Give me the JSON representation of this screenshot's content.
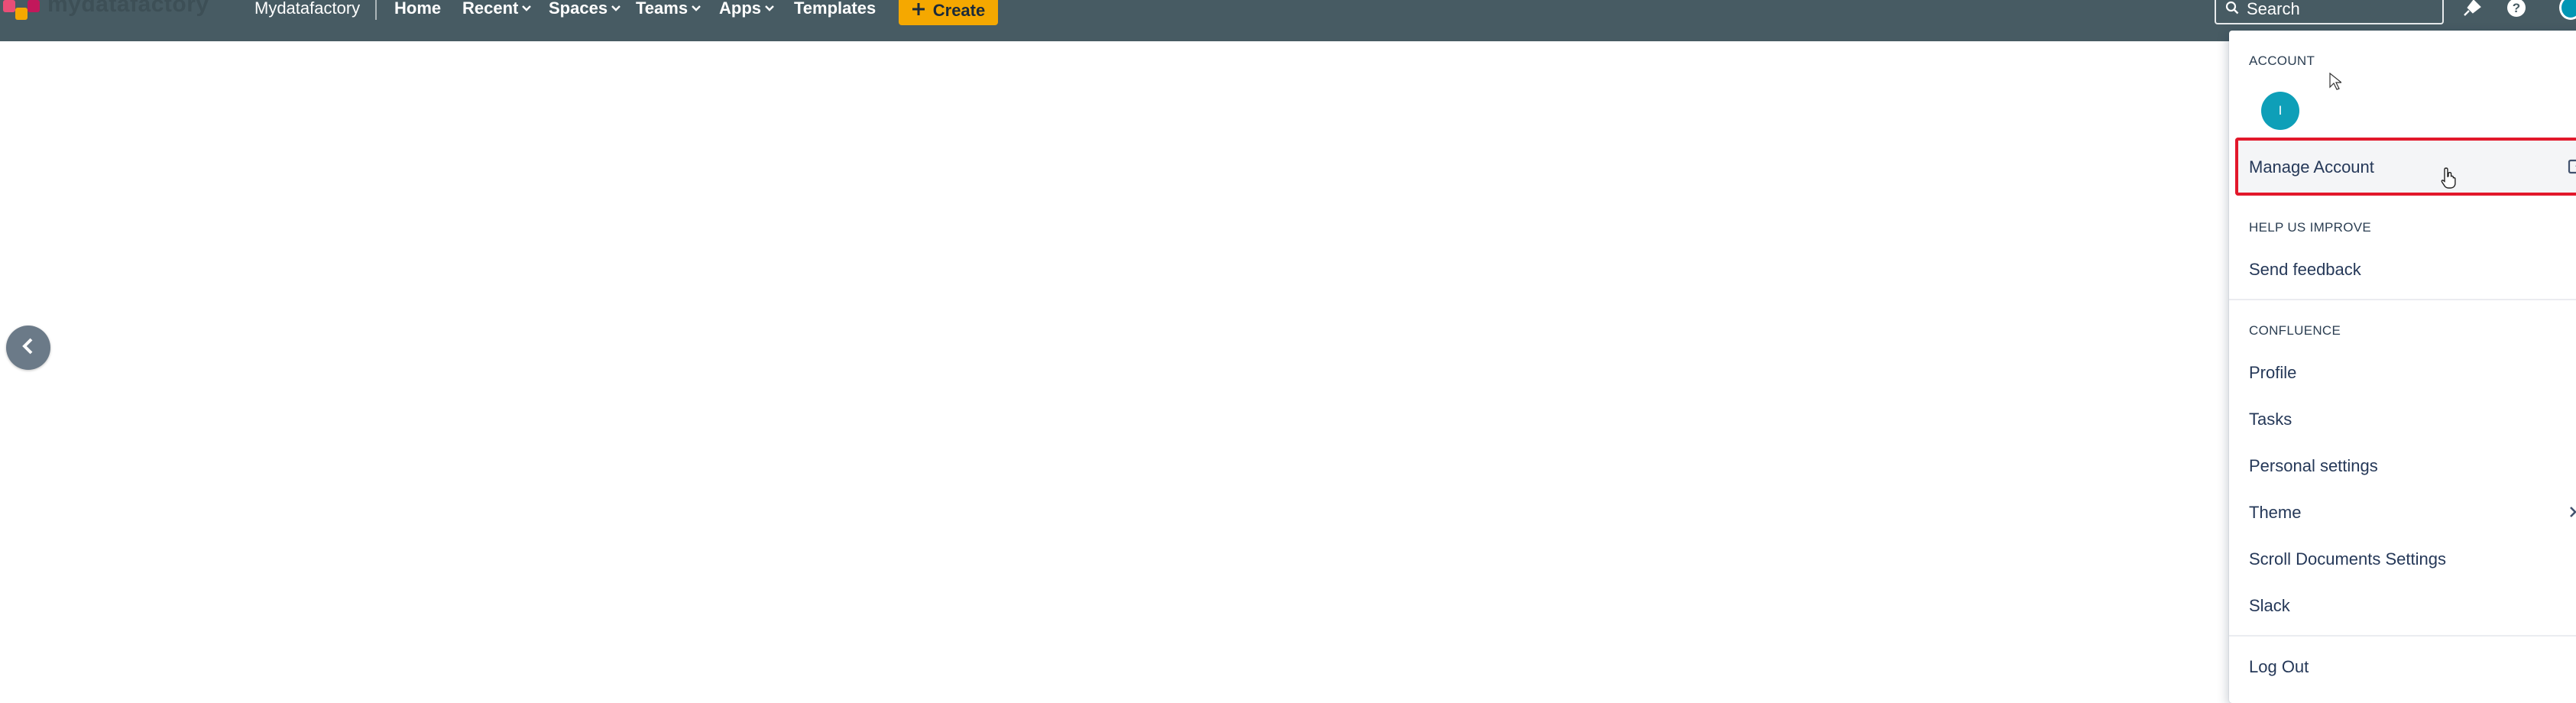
{
  "topbar": {
    "logo_text": "mydatafactory",
    "site_name": "Mydatafactory",
    "nav": [
      {
        "label": "Home",
        "has_chevron": false
      },
      {
        "label": "Recent",
        "has_chevron": true
      },
      {
        "label": "Spaces",
        "has_chevron": true
      },
      {
        "label": "Teams",
        "has_chevron": true
      },
      {
        "label": "Apps",
        "has_chevron": true
      },
      {
        "label": "Templates",
        "has_chevron": false
      }
    ],
    "create_label": "Create",
    "search_placeholder": "Search",
    "icons": [
      "notifications-icon",
      "help-icon",
      "avatar"
    ]
  },
  "dropdown": {
    "account_heading": "ACCOUNT",
    "avatar_initial": "I",
    "manage_account": "Manage Account",
    "help_heading": "HELP US IMPROVE",
    "send_feedback": "Send feedback",
    "confluence_heading": "CONFLUENCE",
    "items": [
      {
        "label": "Profile"
      },
      {
        "label": "Tasks"
      },
      {
        "label": "Personal settings"
      },
      {
        "label": "Theme"
      },
      {
        "label": "Scroll Documents Settings"
      },
      {
        "label": "Slack"
      }
    ],
    "logout": "Log Out"
  },
  "colors": {
    "topbar": "#475b63",
    "create": "#f5a800",
    "highlight": "#e2182b",
    "avatar": "#0e9fb8"
  }
}
